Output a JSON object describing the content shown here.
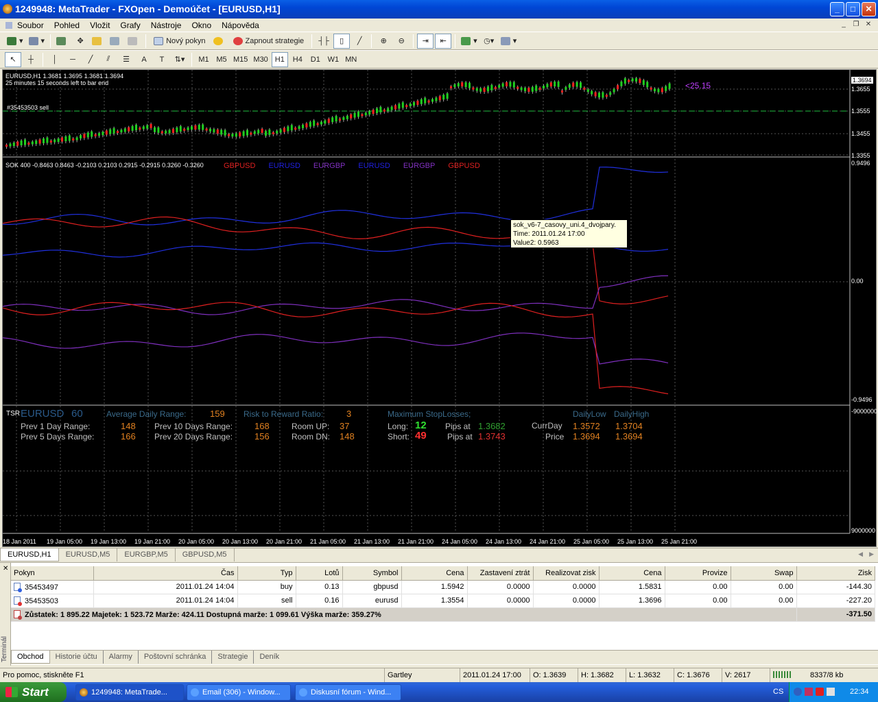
{
  "window": {
    "title": "1249948: MetaTrader - FXOpen - Demoúčet - [EURUSD,H1]"
  },
  "menu": [
    "Soubor",
    "Pohled",
    "Vložit",
    "Grafy",
    "Nástroje",
    "Okno",
    "Nápověda"
  ],
  "toolbar1": {
    "new_order": "Nový pokyn",
    "strategy": "Zapnout strategie"
  },
  "timeframes": [
    "M1",
    "M5",
    "M15",
    "M30",
    "H1",
    "H4",
    "D1",
    "W1",
    "MN"
  ],
  "active_timeframe": "H1",
  "chart": {
    "symbol_line": "EURUSD,H1  1.3681 1.3695 1.3681 1.3694",
    "countdown": "25 minutes 15 seconds left to bar end",
    "order_label": "#35453503 sell",
    "price_tag": "<25.15",
    "price_scale": [
      "1.3694",
      "1.3655",
      "1.3555",
      "1.3455",
      "1.3355"
    ],
    "indicator_line": "SOK 400 -0.8463 0.8463 -0.2103 0.2103 0.2915 -0.2915 0.3260 -0.3260",
    "legend": [
      {
        "label": "GBPUSD",
        "color": "#e02020"
      },
      {
        "label": "EURUSD",
        "color": "#2020e0"
      },
      {
        "label": "EURGBP",
        "color": "#8030c0"
      },
      {
        "label": "EURUSD",
        "color": "#2020e0"
      },
      {
        "label": "EURGBP",
        "color": "#8030c0"
      },
      {
        "label": "GBPUSD",
        "color": "#e02020"
      }
    ],
    "indicator_scale": [
      "0.9496",
      "0.00",
      "-0.9496"
    ],
    "tsr_scale": [
      "-9000000",
      "9000000"
    ],
    "time_labels": [
      "18 Jan 2011",
      "19 Jan 05:00",
      "19 Jan 13:00",
      "19 Jan 21:00",
      "20 Jan 05:00",
      "20 Jan 13:00",
      "20 Jan 21:00",
      "21 Jan 05:00",
      "21 Jan 13:00",
      "21 Jan 21:00",
      "24 Jan 05:00",
      "24 Jan 13:00",
      "24 Jan 21:00",
      "25 Jan 05:00",
      "25 Jan 13:00",
      "25 Jan 21:00"
    ],
    "tooltip": {
      "name": "sok_v6-7_casovy_uni.4_dvojpary.",
      "time": "Time: 2011.01.24 17:00",
      "value": "Value2: 0.5963"
    }
  },
  "tsr": {
    "label": "TSR",
    "symbol": "EURUSD",
    "period": "60",
    "adr_label": "Average Daily Range:",
    "adr_value": "159",
    "rr_label": "Risk to Reward Ratio:",
    "rr_value": "3",
    "prev1_label": "Prev 1 Day Range:",
    "prev1_value": "148",
    "prev5_label": "Prev 5 Days Range:",
    "prev5_value": "166",
    "prev10_label": "Prev 10 Days Range:",
    "prev10_value": "168",
    "prev20_label": "Prev 20 Days Range:",
    "prev20_value": "156",
    "roomup_label": "Room UP:",
    "roomup_value": "37",
    "roomdn_label": "Room DN:",
    "roomdn_value": "148",
    "maxsl_label": "Maximum StopLosses;",
    "long_label": "Long:",
    "long_value": "12",
    "long_pips_label": "Pips at",
    "long_price": "1.3682",
    "short_label": "Short:",
    "short_value": "49",
    "short_pips_label": "Pips at",
    "short_price": "1.3743",
    "dailylow_label": "DailyLow",
    "dailyhigh_label": "DailyHigh",
    "curday_label": "CurrDay",
    "curday_low": "1.3572",
    "curday_high": "1.3704",
    "price_label": "Price",
    "price_low": "1.3694",
    "price_high": "1.3694"
  },
  "chart_tabs": [
    "EURUSD,H1",
    "EURUSD,M5",
    "EURGBP,M5",
    "GBPUSD,M5"
  ],
  "terminal": {
    "side_label": "Terminál",
    "columns": [
      "Pokyn",
      "Čas",
      "Typ",
      "Lotů",
      "Symbol",
      "Cena",
      "Zastavení ztrát",
      "Realizovat zisk",
      "Cena",
      "Provize",
      "Swap",
      "Zisk"
    ],
    "rows": [
      {
        "order": "35453497",
        "time": "2011.01.24 14:04",
        "type": "buy",
        "lots": "0.13",
        "symbol": "gbpusd",
        "price": "1.5942",
        "sl": "0.0000",
        "tp": "0.0000",
        "cur": "1.5831",
        "comm": "0.00",
        "swap": "0.00",
        "profit": "-144.30"
      },
      {
        "order": "35453503",
        "time": "2011.01.24 14:04",
        "type": "sell",
        "lots": "0.16",
        "symbol": "eurusd",
        "price": "1.3554",
        "sl": "0.0000",
        "tp": "0.0000",
        "cur": "1.3696",
        "comm": "0.00",
        "swap": "0.00",
        "profit": "-227.20"
      }
    ],
    "balance_line": "Zůstatek: 1 895.22  Majetek: 1 523.72  Marže: 424.11  Dostupná marže: 1 099.61  Výška marže: 359.27%",
    "total": "-371.50",
    "tabs": [
      "Obchod",
      "Historie účtu",
      "Alarmy",
      "Poštovní schránka",
      "Strategie",
      "Deník"
    ]
  },
  "status": {
    "help": "Pro pomoc, stiskněte F1",
    "profile": "Gartley",
    "datetime": "2011.01.24 17:00",
    "open": "O: 1.3639",
    "high": "H: 1.3682",
    "low": "L: 1.3632",
    "close": "C: 1.3676",
    "volume": "V: 2617",
    "traffic": "8337/8 kb"
  },
  "taskbar": {
    "start": "Start",
    "tasks": [
      "1249948: MetaTrade...",
      "Email (306) - Window...",
      "Diskusní fórum - Wind..."
    ],
    "lang": "CS",
    "clock": "22:34"
  }
}
